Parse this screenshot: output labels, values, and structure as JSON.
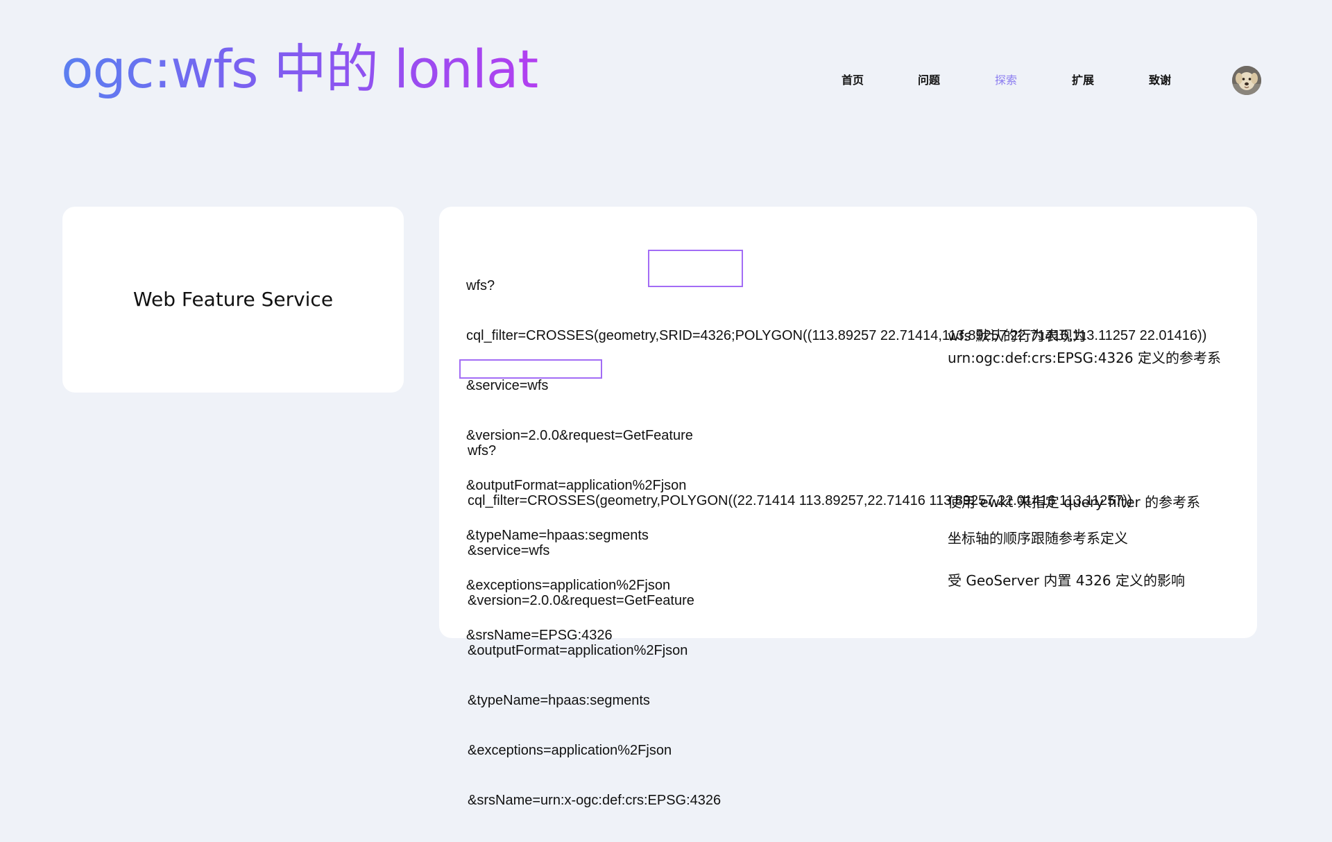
{
  "header": {
    "title": "ogc:wfs 中的 lonlat",
    "title_gradient": [
      "#5b7ff0",
      "#7f5cf0",
      "#b23ff0"
    ]
  },
  "nav": {
    "items": [
      {
        "label": "首页",
        "active": false
      },
      {
        "label": "问题",
        "active": false
      },
      {
        "label": "探索",
        "active": true
      },
      {
        "label": "扩展",
        "active": false
      },
      {
        "label": "致谢",
        "active": false
      }
    ],
    "active_color": "#8b7cf0",
    "avatar": "dog-avatar"
  },
  "left_card": {
    "heading": "Web Feature Service"
  },
  "right_card": {
    "block1": {
      "lines": [
        "wfs?",
        "cql_filter=CROSSES(geometry,SRID=4326;POLYGON((113.89257 22.71414,113.89257 22.71416,113.11257 22.01416))",
        "&service=wfs",
        "&version=2.0.0&request=GetFeature",
        "&outputFormat=application%2Fjson",
        "&typeName=hpaas:segments",
        "&exceptions=application%2Fjson",
        "&srsName=EPSG:4326"
      ],
      "note_lines": [
        "wfs 默认的行为表现为",
        "urn:ogc:def:crs:EPSG:4326 定义的参考系"
      ]
    },
    "block2": {
      "lines": [
        "wfs?",
        "cql_filter=CROSSES(geometry,POLYGON((22.71414 113.89257,22.71416 113.89257,22.01416 113.11257))",
        "&service=wfs",
        "&version=2.0.0&request=GetFeature",
        "&outputFormat=application%2Fjson",
        "&typeName=hpaas:segments",
        "&exceptions=application%2Fjson",
        "&srsName=urn:x-ogc:def:crs:EPSG:4326"
      ],
      "notes": [
        "使用 ewkt 来指定 query filter 的参考系",
        "坐标轴的顺序跟随参考系定义",
        "受 GeoServer 内置 4326 定义的影响"
      ]
    },
    "highlight_color": "#a26cf5"
  }
}
